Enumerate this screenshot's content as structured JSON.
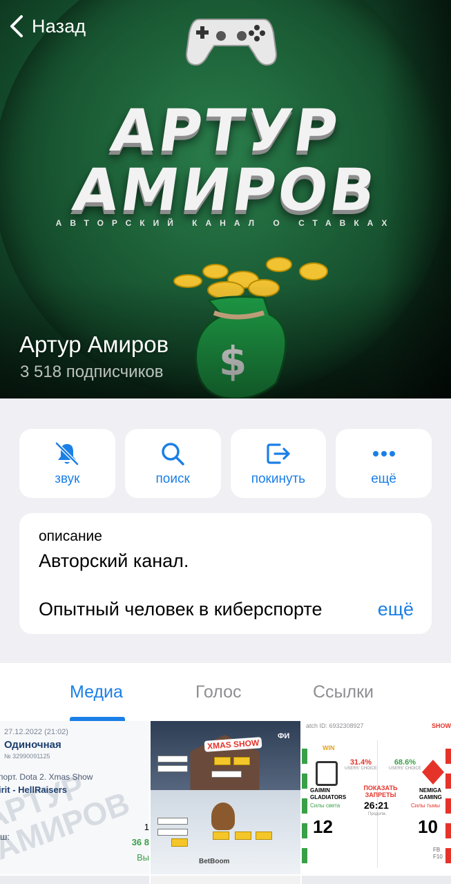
{
  "nav": {
    "back_label": "Назад"
  },
  "cover": {
    "logo_line1": "АРТУР",
    "logo_line2": "АМИРОВ",
    "logo_subtitle": "АВТОРСКИЙ КАНАЛ О СТАВКАХ",
    "channel_name": "Артур Амиров",
    "subscribers": "3 518 подписчиков"
  },
  "actions": [
    {
      "label": "звук",
      "icon": "bell-slash-icon"
    },
    {
      "label": "поиск",
      "icon": "search-icon"
    },
    {
      "label": "покинуть",
      "icon": "leave-icon"
    },
    {
      "label": "ещё",
      "icon": "more-dots-icon"
    }
  ],
  "description": {
    "heading": "описание",
    "line1": "Авторский канал.",
    "line2": "Опытный человек в киберспорте",
    "more": "ещё"
  },
  "tabs": [
    {
      "label": "Медиа",
      "active": true
    },
    {
      "label": "Голос",
      "active": false
    },
    {
      "label": "Ссылки",
      "active": false
    }
  ],
  "media": {
    "bet_slip": {
      "date": "27.12.2022 (21:02)",
      "kind": "Одиночная",
      "number": "№ 32990091125",
      "sport": "порт. Dota 2. Xmas Show",
      "match": "irit - HellRaisers",
      "watermark_line1": "АРТУР",
      "watermark_line2": "АМИРОВ",
      "label": "ш:",
      "value1": "1",
      "amount": "36 8",
      "status": "Вы"
    },
    "bracket": {
      "title": "XMAS SHOW",
      "side_text": "ФИ",
      "sponsor": "BetBoom"
    },
    "match_card": {
      "match_id": "atch ID: 6932308927",
      "show": "SHOW",
      "win": "WIN",
      "left_pct": "31.4%",
      "right_pct": "68.6%",
      "users_choice": "USERS' CHOICE",
      "left_team": "GAIMIN GLADIATORS",
      "right_team": "NEMIGA GAMING",
      "left_side": "Силы света",
      "right_side": "Силы тьмы",
      "bans": "ПОКАЗАТЬ ЗАПРЕТЫ",
      "time": "26:21",
      "duration": "Продолж.",
      "left_score": "12",
      "right_score": "10",
      "fb": "FB",
      "f10": "F10"
    }
  },
  "colors": {
    "accent": "#1a7fe6",
    "background": "#efeff4",
    "cover_green": "#1a5a34"
  }
}
